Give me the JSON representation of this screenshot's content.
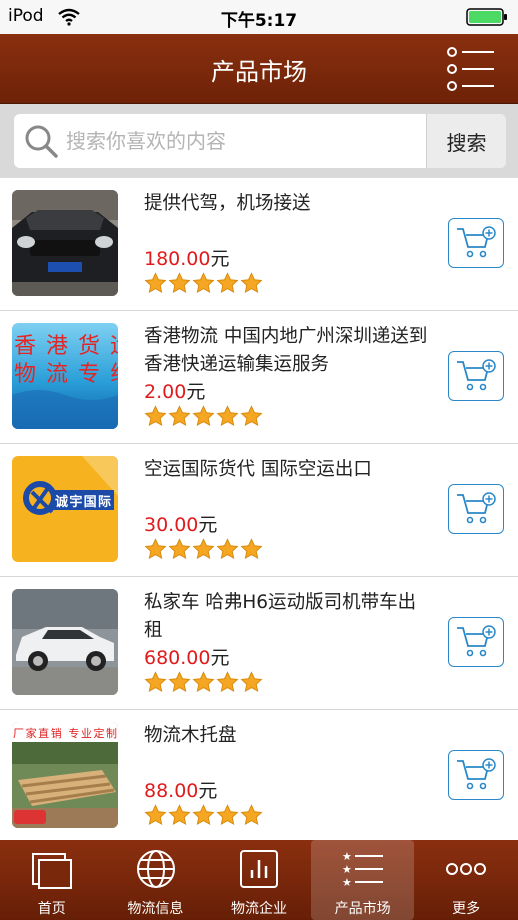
{
  "status_bar": {
    "carrier": "iPod",
    "time": "下午5:17"
  },
  "nav": {
    "title": "产品市场",
    "menu_icon": "list-menu-icon"
  },
  "search": {
    "placeholder": "搜索你喜欢的内容",
    "value": "",
    "button_label": "搜索"
  },
  "products": [
    {
      "title": "提供代驾，机场接送",
      "price": "180.00",
      "unit": "元",
      "rating": 5,
      "thumb": "black-car-photo"
    },
    {
      "title": "香港物流 中国内地广州深圳递送到香港快递运输集运服务",
      "price": "2.00",
      "unit": "元",
      "rating": 5,
      "thumb": "hk-logistics-banner",
      "thumb_text": [
        "香港货运",
        "物流专线"
      ]
    },
    {
      "title": "空运国际货代 国际空运出口",
      "price": "30.00",
      "unit": "元",
      "rating": 5,
      "thumb": "chengyu-logo",
      "thumb_text": [
        "诚宇国际"
      ]
    },
    {
      "title": "私家车 哈弗H6运动版司机带车出租",
      "price": "680.00",
      "unit": "元",
      "rating": 5,
      "thumb": "white-suv-photo"
    },
    {
      "title": "物流木托盘",
      "price": "88.00",
      "unit": "元",
      "rating": 5,
      "thumb": "wooden-pallet-photo",
      "thumb_text": [
        "厂家直销 专业定制"
      ]
    }
  ],
  "tabs": [
    {
      "label": "首页",
      "icon": "home-icon",
      "active": false
    },
    {
      "label": "物流信息",
      "icon": "globe-icon",
      "active": false
    },
    {
      "label": "物流企业",
      "icon": "bar-chart-icon",
      "active": false
    },
    {
      "label": "产品市场",
      "icon": "star-list-icon",
      "active": true
    },
    {
      "label": "更多",
      "icon": "more-dots-icon",
      "active": false
    }
  ],
  "colors": {
    "nav_brown": "#7a280b",
    "price_red": "#e01b1b",
    "star_orange": "#f5a623",
    "cart_blue": "#2a88c8"
  }
}
